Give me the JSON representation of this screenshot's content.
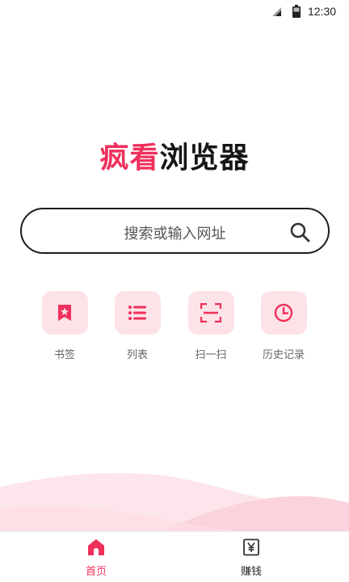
{
  "status_bar": {
    "time": "12:30",
    "signal_icon": "signal-icon",
    "battery_icon": "battery-icon"
  },
  "logo": {
    "accent_text": "疯看",
    "dark_text": "浏览器",
    "accent_color": "#f0305c"
  },
  "search": {
    "placeholder": "搜索或输入网址",
    "icon": "search-icon"
  },
  "shortcuts": [
    {
      "label": "书签",
      "icon": "bookmark-icon"
    },
    {
      "label": "列表",
      "icon": "list-icon"
    },
    {
      "label": "扫一扫",
      "icon": "scan-icon"
    },
    {
      "label": "历史记录",
      "icon": "history-clock-icon"
    }
  ],
  "tabs": [
    {
      "label": "首页",
      "icon": "home-icon",
      "active": true
    },
    {
      "label": "赚钱",
      "icon": "yen-icon",
      "active": false
    }
  ],
  "colors": {
    "accent": "#f0305c",
    "tile_bg": "#fde3e7",
    "wave": "#fbd3dc"
  }
}
